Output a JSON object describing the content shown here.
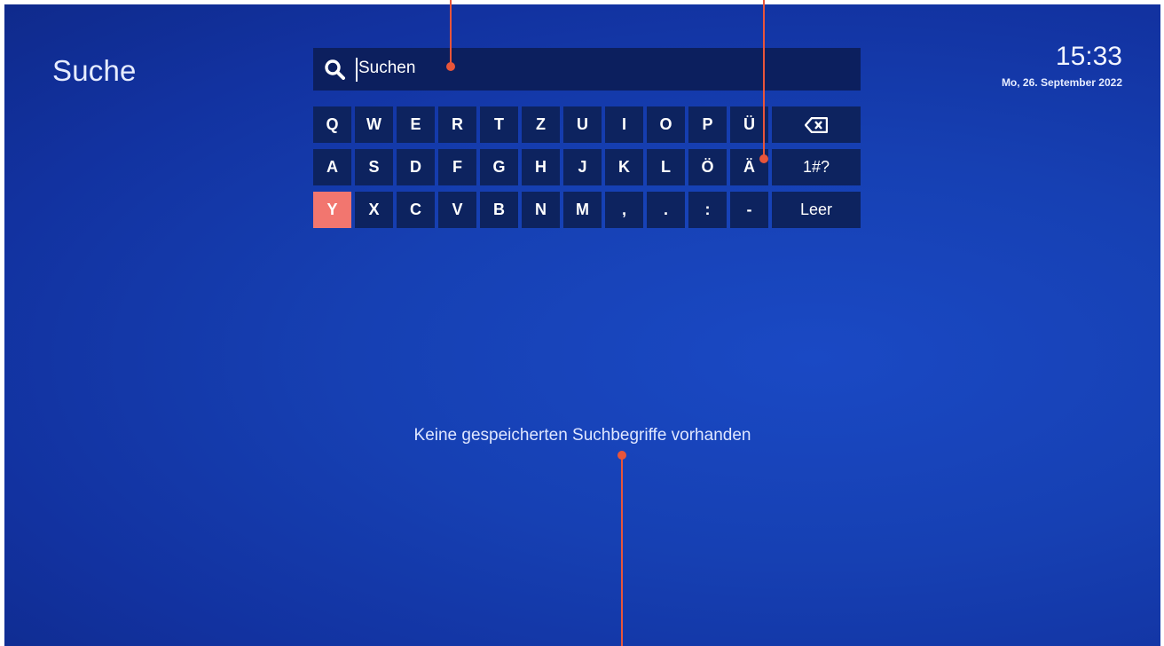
{
  "page": {
    "title": "Suche"
  },
  "search": {
    "text": "Suchen",
    "icon": "search-icon"
  },
  "status": {
    "time": "15:33",
    "date": "Mo, 26. September 2022"
  },
  "keyboard": {
    "rows": [
      [
        "Q",
        "W",
        "E",
        "R",
        "T",
        "Z",
        "U",
        "I",
        "O",
        "P",
        "Ü"
      ],
      [
        "A",
        "S",
        "D",
        "F",
        "G",
        "H",
        "J",
        "K",
        "L",
        "Ö",
        "Ä"
      ],
      [
        "Y",
        "X",
        "C",
        "V",
        "B",
        "N",
        "M",
        ",",
        ".",
        ":",
        "-"
      ]
    ],
    "wide_keys": [
      "backspace",
      "1#?",
      "Leer"
    ],
    "backspace_icon": "backspace-icon",
    "focused_key": "Y"
  },
  "history": {
    "empty_message": "Keine gespeicherten Suchbegriffe vorhanden"
  },
  "colors": {
    "background": "#1640b3",
    "key_background": "#0d235f",
    "focus": "#f2766f",
    "callout": "#e8553a"
  }
}
